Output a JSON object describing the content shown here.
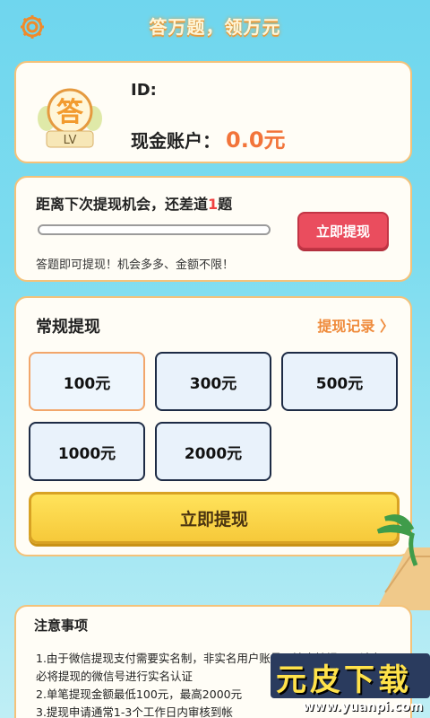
{
  "header": {
    "title": "答万题，领万元"
  },
  "account": {
    "avatar_char": "答",
    "level_badge": "LV",
    "id_label": "ID:",
    "cash_label": "现金账户：",
    "cash_value": "0.0元"
  },
  "progress": {
    "text_before": "距离下次提现机会，还差道",
    "remaining": "1",
    "text_after": "题",
    "progress": 0.0,
    "button": "立即提现",
    "hint": "答题即可提现！机会多多、金额不限！"
  },
  "withdraw": {
    "title": "常规提现",
    "record_link": "提现记录 〉",
    "options": [
      "100元",
      "300元",
      "500元",
      "1000元",
      "2000元"
    ],
    "selected_index": 0,
    "submit": "立即提现"
  },
  "notes": {
    "title": "注意事项",
    "lines": [
      "1.由于微信提现支付需要实名制，非实名用户账号无法支持提现，请务必将提现的微信号进行实名认证",
      "2.单笔提现金额最低100元，最高2000元",
      "3.提现申请通常1-3个工作日内审核到帐"
    ]
  },
  "watermark": {
    "text": "元皮下载",
    "url": "www.yuanpi.com"
  }
}
